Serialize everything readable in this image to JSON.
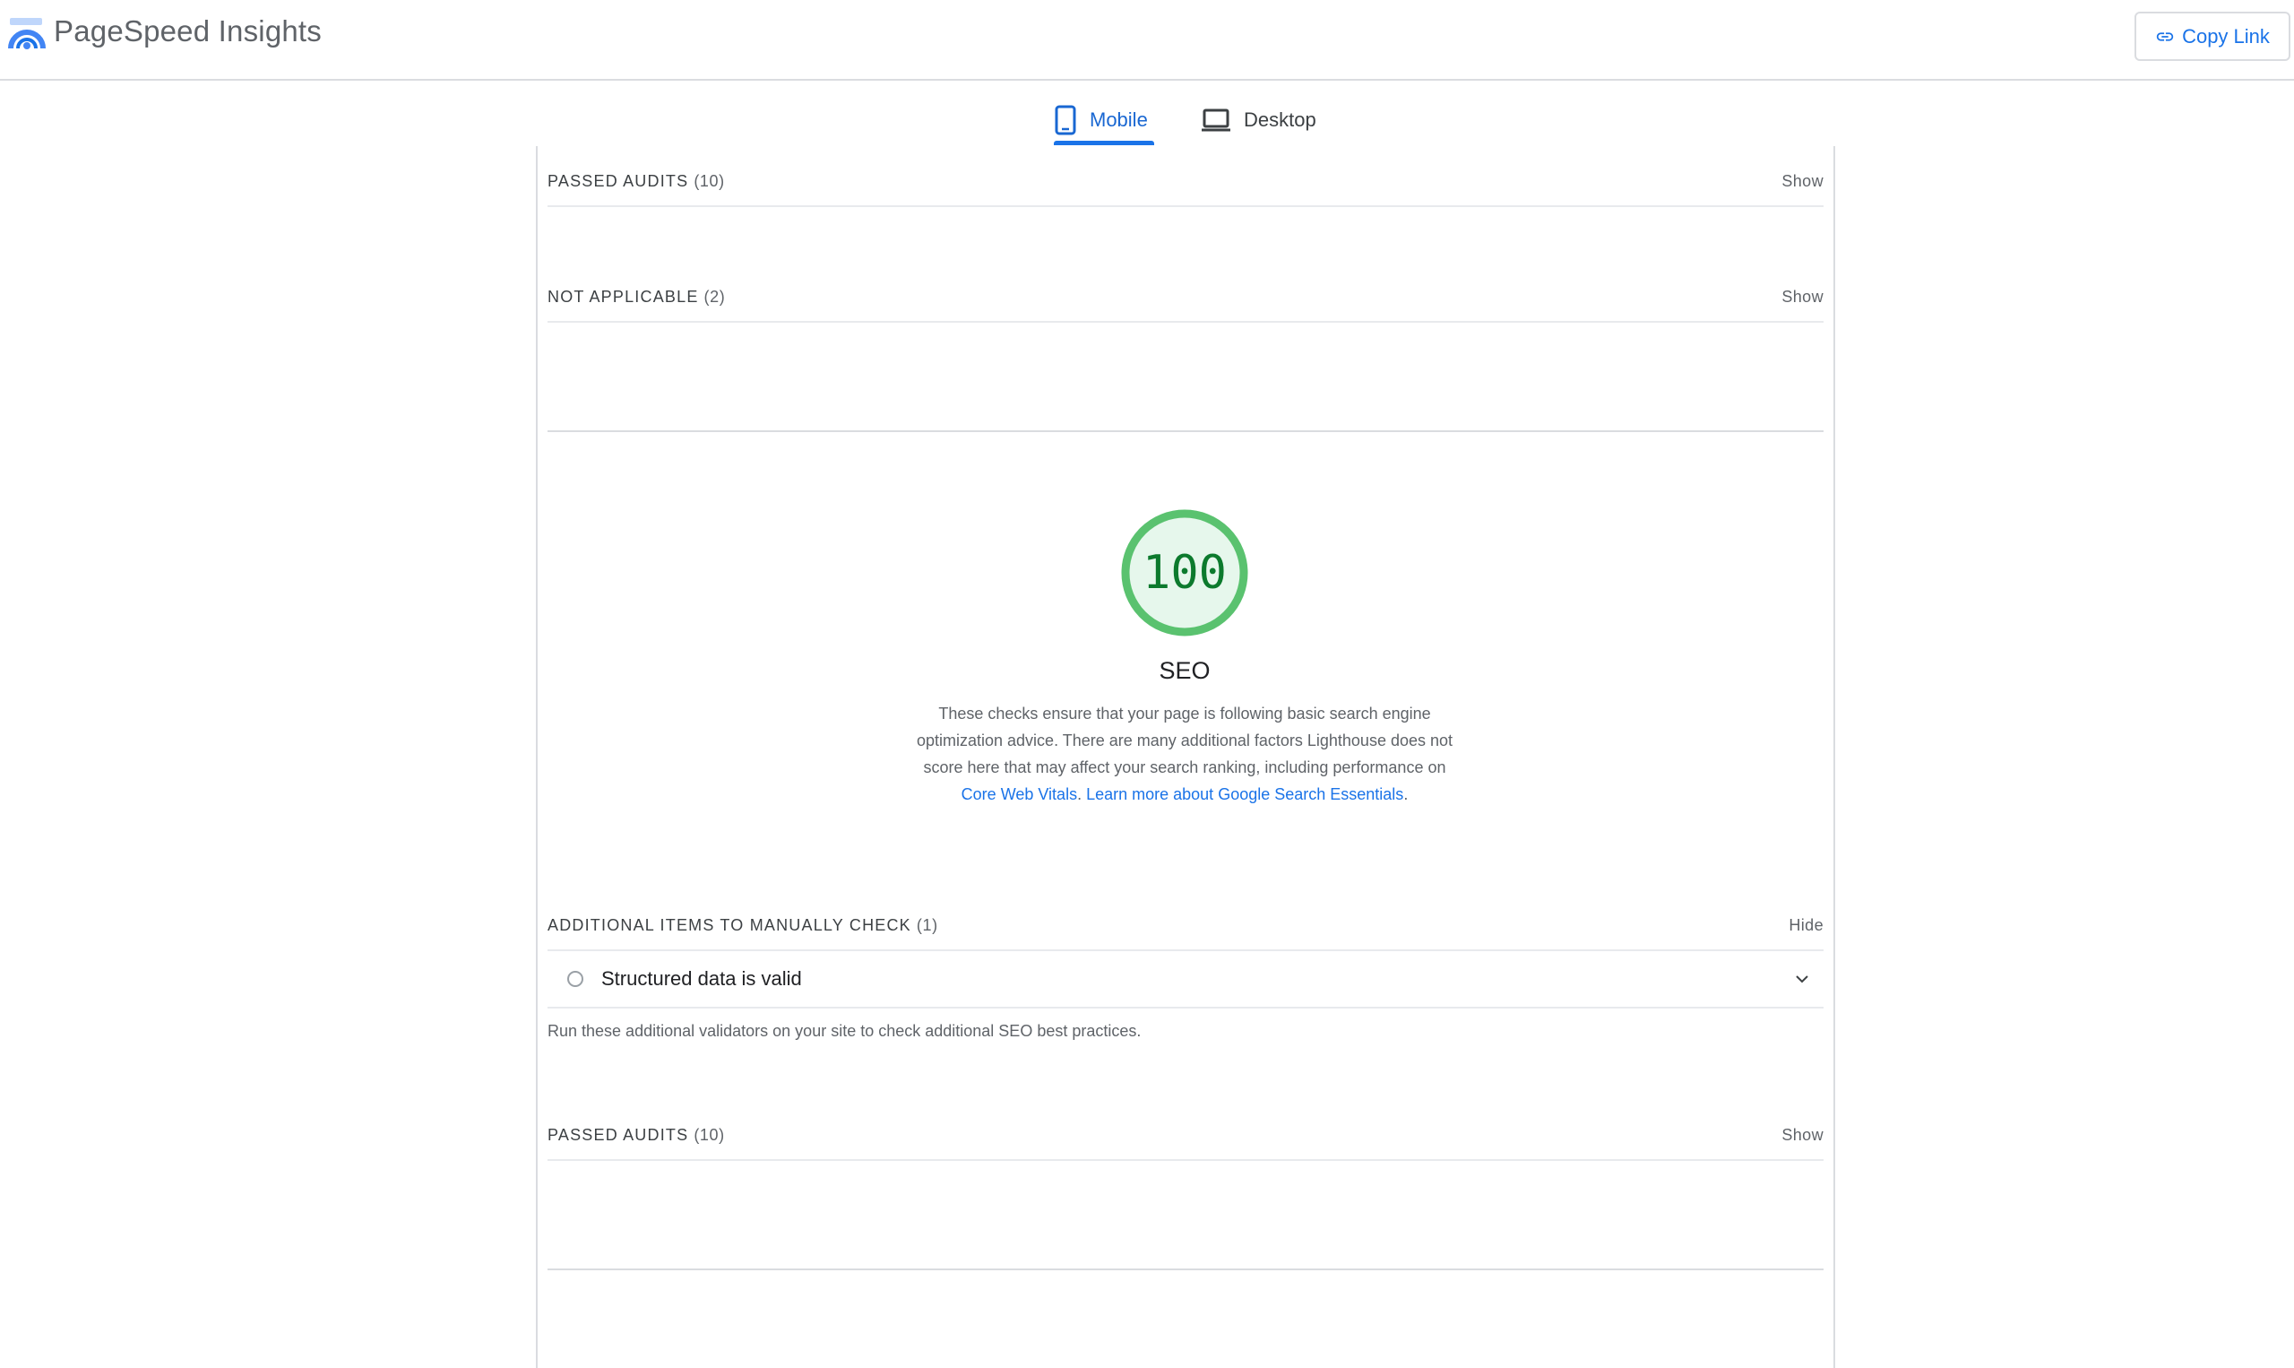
{
  "app": {
    "title": "PageSpeed Insights",
    "copy_link_label": "Copy Link"
  },
  "tabs": [
    {
      "label": "Mobile",
      "active": true
    },
    {
      "label": "Desktop",
      "active": false
    }
  ],
  "sections_top": [
    {
      "title": "PASSED AUDITS",
      "count": "(10)",
      "toggle": "Show"
    },
    {
      "title": "NOT APPLICABLE",
      "count": "(2)",
      "toggle": "Show"
    }
  ],
  "category": {
    "score": "100",
    "score_fraction": 1.0,
    "title": "SEO",
    "desc_text": "These checks ensure that your page is following basic search engine optimization advice. There are many additional factors Lighthouse does not score here that may affect your search ranking, including performance on ",
    "link1": "Core Web Vitals",
    "sep": ". ",
    "link2": "Learn more about Google Search Essentials",
    "end": "."
  },
  "manual": {
    "title": "ADDITIONAL ITEMS TO MANUALLY CHECK",
    "count": "(1)",
    "toggle": "Hide",
    "item_label": "Structured data is valid",
    "description": "Run these additional validators on your site to check additional SEO best practices."
  },
  "passed_bottom": {
    "title": "PASSED AUDITS",
    "count": "(10)",
    "toggle": "Show"
  },
  "colors": {
    "accent": "#1a73e8",
    "pass": "#0cce6b",
    "pass_text": "#0c7a2d"
  },
  "icons": [
    "pagespeed-logo-icon",
    "link-icon",
    "mobile-phone-icon",
    "laptop-icon",
    "chevron-down-icon",
    "audit-status-circle-icon"
  ]
}
